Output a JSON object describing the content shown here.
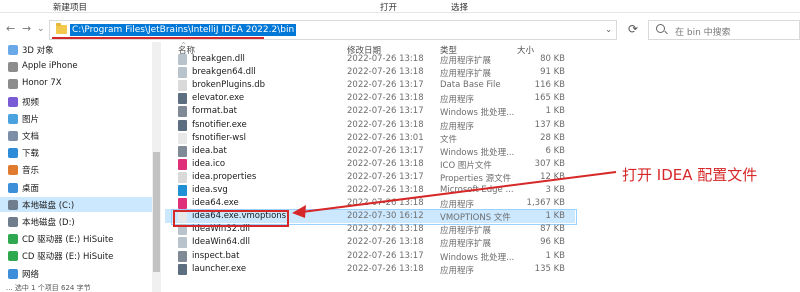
{
  "ribbon": {
    "tabs": [
      "新建项目",
      "打开",
      "选择"
    ]
  },
  "address": {
    "path": "C:\\Program Files\\JetBrains\\IntelliJ IDEA 2022.2\\bin"
  },
  "search": {
    "placeholder": "在 bin 中搜索"
  },
  "sidebar": {
    "items": [
      {
        "label": "3D 对象",
        "icon": "cube-icon",
        "color": "#6aa8e8"
      },
      {
        "label": "Apple iPhone",
        "icon": "phone-icon",
        "color": "#8c8c8c"
      },
      {
        "label": "Honor 7X",
        "icon": "phone-icon",
        "color": "#8c8c8c"
      },
      {
        "label": "视频",
        "icon": "video-icon",
        "color": "#7a5bd6"
      },
      {
        "label": "图片",
        "icon": "picture-icon",
        "color": "#4aa3df"
      },
      {
        "label": "文档",
        "icon": "document-icon",
        "color": "#7c8fa6"
      },
      {
        "label": "下载",
        "icon": "download-icon",
        "color": "#2e8bd8"
      },
      {
        "label": "音乐",
        "icon": "music-icon",
        "color": "#e07a2e"
      },
      {
        "label": "桌面",
        "icon": "desktop-icon",
        "color": "#3d8fd9"
      },
      {
        "label": "本地磁盘 (C:)",
        "icon": "drive-icon",
        "color": "#6f7d8c"
      },
      {
        "label": "本地磁盘 (D:)",
        "icon": "drive-icon",
        "color": "#6f7d8c"
      },
      {
        "label": "CD 驱动器 (E:) HiSuite",
        "icon": "hisuite-icon",
        "color": "#2fa84f"
      },
      {
        "label": "CD 驱动器 (E:) HiSuite",
        "icon": "hisuite-icon",
        "color": "#2fa84f"
      },
      {
        "label": "网络",
        "icon": "network-icon",
        "color": "#3d8fd9"
      }
    ],
    "selected_index": 9
  },
  "columns": {
    "name": "名称",
    "modified": "修改日期",
    "type": "类型",
    "size": "大小"
  },
  "files": [
    {
      "name": "breakgen.dll",
      "date": "2022-07-26 13:18",
      "type": "应用程序扩展",
      "size": "80 KB",
      "icon": "dll-icon",
      "color": "#b9c3cc"
    },
    {
      "name": "breakgen64.dll",
      "date": "2022-07-26 13:18",
      "type": "应用程序扩展",
      "size": "91 KB",
      "icon": "dll-icon",
      "color": "#b9c3cc"
    },
    {
      "name": "brokenPlugins.db",
      "date": "2022-07-26 13:17",
      "type": "Data Base File",
      "size": "116 KB",
      "icon": "db-icon",
      "color": "#d9d9d9"
    },
    {
      "name": "elevator.exe",
      "date": "2022-07-26 13:18",
      "type": "应用程序",
      "size": "165 KB",
      "icon": "exe-icon",
      "color": "#5c6e80"
    },
    {
      "name": "format.bat",
      "date": "2022-07-26 13:17",
      "type": "Windows 批处理...",
      "size": "1 KB",
      "icon": "bat-icon",
      "color": "#7f8a96"
    },
    {
      "name": "fsnotifier.exe",
      "date": "2022-07-26 13:18",
      "type": "应用程序",
      "size": "137 KB",
      "icon": "exe-icon",
      "color": "#5c6e80"
    },
    {
      "name": "fsnotifier-wsl",
      "date": "2022-07-26 13:01",
      "type": "文件",
      "size": "28 KB",
      "icon": "file-icon",
      "color": "#e8e8e8"
    },
    {
      "name": "idea.bat",
      "date": "2022-07-26 13:17",
      "type": "Windows 批处理...",
      "size": "6 KB",
      "icon": "bat-icon",
      "color": "#7f8a96"
    },
    {
      "name": "idea.ico",
      "date": "2022-07-26 13:18",
      "type": "ICO 图片文件",
      "size": "307 KB",
      "icon": "idea-icon",
      "color": "#e0307a"
    },
    {
      "name": "idea.properties",
      "date": "2022-07-26 13:17",
      "type": "Properties 源文件",
      "size": "12 KB",
      "icon": "properties-icon",
      "color": "#d9d9d9"
    },
    {
      "name": "idea.svg",
      "date": "2022-07-26 13:18",
      "type": "Microsoft Edge ...",
      "size": "3 KB",
      "icon": "edge-icon",
      "color": "#1f8fd6"
    },
    {
      "name": "idea64.exe",
      "date": "2022-07-26 13:18",
      "type": "应用程序",
      "size": "1,367 KB",
      "icon": "idea-icon",
      "color": "#e0307a"
    },
    {
      "name": "idea64.exe.vmoptions",
      "date": "2022-07-30 16:12",
      "type": "VMOPTIONS 文件",
      "size": "1 KB",
      "icon": "file-icon",
      "color": "#e8e8e8"
    },
    {
      "name": "IdeaWin32.dll",
      "date": "2022-07-26 13:18",
      "type": "应用程序扩展",
      "size": "87 KB",
      "icon": "dll-icon",
      "color": "#b9c3cc"
    },
    {
      "name": "IdeaWin64.dll",
      "date": "2022-07-26 13:18",
      "type": "应用程序扩展",
      "size": "96 KB",
      "icon": "dll-icon",
      "color": "#b9c3cc"
    },
    {
      "name": "inspect.bat",
      "date": "2022-07-26 13:17",
      "type": "Windows 批处理...",
      "size": "1 KB",
      "icon": "bat-icon",
      "color": "#7f8a96"
    },
    {
      "name": "launcher.exe",
      "date": "2022-07-26 13:18",
      "type": "应用程序",
      "size": "135 KB",
      "icon": "exe-icon",
      "color": "#5c6e80"
    }
  ],
  "selected_file_index": 12,
  "annotation": {
    "text": "打开 IDEA 配置文件",
    "color": "#d62828"
  },
  "status": {
    "text": "... 选中 1 个项目 624 字节"
  }
}
